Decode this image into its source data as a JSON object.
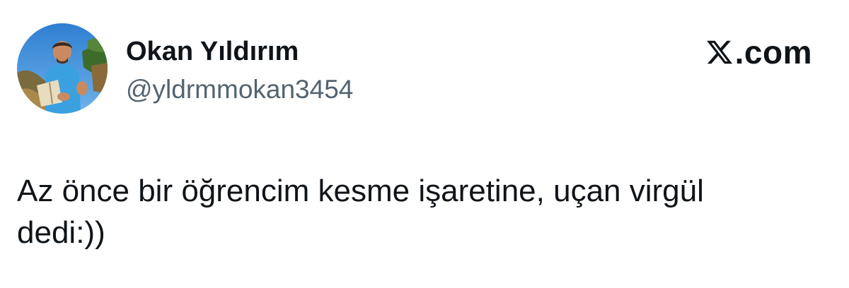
{
  "author": {
    "display_name": "Okan Yıldırım",
    "handle": "@yldrmmokan3454"
  },
  "brand": {
    "icon": "x-logo-icon",
    "label": ".com"
  },
  "tweet": {
    "text": "Az önce bir öğrencim kesme işaretine, uçan virgül\ndedi:))"
  },
  "colors": {
    "text_primary": "#0f1419",
    "text_secondary": "#536471",
    "background": "#ffffff"
  }
}
